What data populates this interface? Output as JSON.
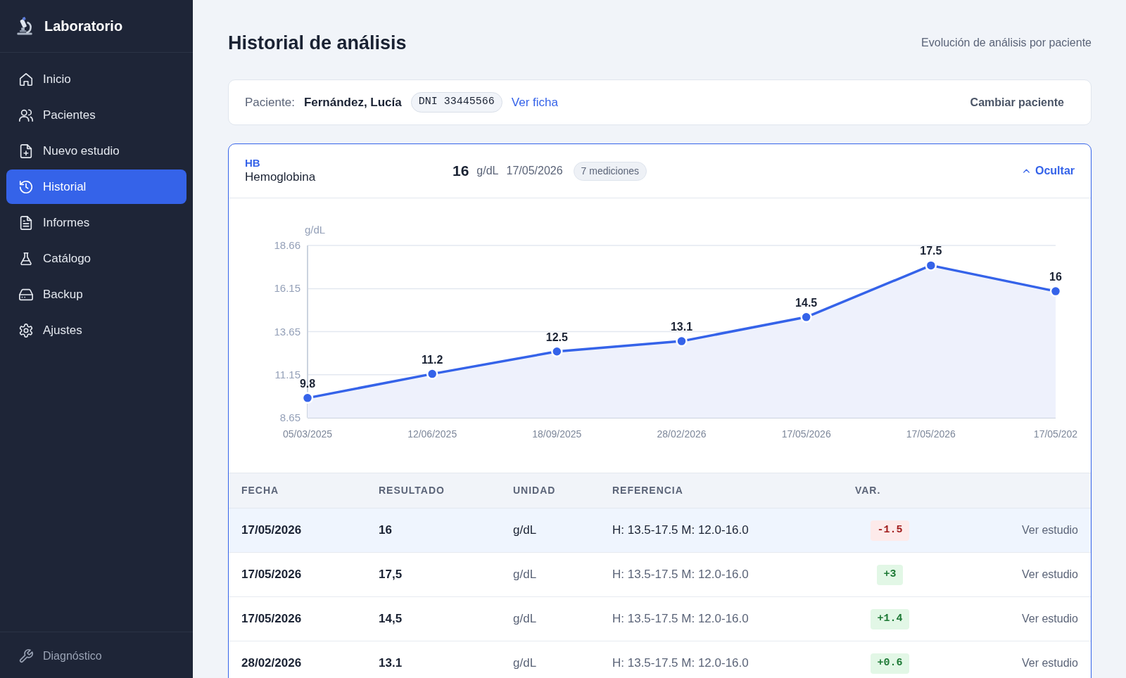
{
  "sidebar": {
    "brand": "Laboratorio",
    "items": [
      {
        "label": "Inicio",
        "selected": false
      },
      {
        "label": "Pacientes",
        "selected": false
      },
      {
        "label": "Nuevo estudio",
        "selected": false
      },
      {
        "label": "Historial",
        "selected": true
      },
      {
        "label": "Informes",
        "selected": false
      },
      {
        "label": "Catálogo",
        "selected": false
      },
      {
        "label": "Backup",
        "selected": false
      },
      {
        "label": "Ajustes",
        "selected": false
      }
    ],
    "footer_item": {
      "label": "Diagnóstico"
    }
  },
  "header": {
    "title": "Historial de análisis",
    "subtitle": "Evolución de análisis por paciente"
  },
  "patient": {
    "label": "Paciente:",
    "name": "Fernández, Lucía",
    "document": "DNI 33445566",
    "link": "Ver ficha",
    "change_button": "Cambiar paciente"
  },
  "analysis": {
    "code": "HB",
    "name": "Hemoglobina",
    "latest_value": "16",
    "unit": "g/dL",
    "date": "17/05/2026",
    "count": "7 mediciones",
    "toggle": {
      "label": "Ocultar",
      "expanded": true
    },
    "chart_data": {
      "type": "area",
      "ylabel": "g/dL",
      "categories": [
        "05/03/2025",
        "12/06/2025",
        "18/09/2025",
        "28/02/2026",
        "17/05/2026",
        "17/05/2026",
        "17/05/202"
      ],
      "values": [
        9.8,
        11.2,
        12.5,
        13.1,
        14.5,
        17.5,
        16
      ],
      "ylim": [
        8.65,
        18.66
      ],
      "yticks": [
        8.65,
        11.15,
        13.65,
        16.15,
        18.66
      ],
      "grid": true,
      "data_labels": true
    },
    "table": {
      "columns": [
        "FECHA",
        "RESULTADO",
        "UNIDAD",
        "REFERENCIA",
        "VAR."
      ],
      "rows": [
        {
          "date": "17/05/2026",
          "result": "16",
          "unit": "g/dL",
          "reference": "H: 13.5-17.5 M: 12.0-16.0",
          "change": "-1.5",
          "negative": true,
          "action": "Ver estudio",
          "selected": true
        },
        {
          "date": "17/05/2026",
          "result": "17,5",
          "unit": "g/dL",
          "reference": "H: 13.5-17.5 M: 12.0-16.0",
          "change": "+3",
          "negative": false,
          "action": "Ver estudio",
          "selected": false
        },
        {
          "date": "17/05/2026",
          "result": "14,5",
          "unit": "g/dL",
          "reference": "H: 13.5-17.5 M: 12.0-16.0",
          "change": "+1.4",
          "negative": false,
          "action": "Ver estudio",
          "selected": false
        },
        {
          "date": "28/02/2026",
          "result": "13.1",
          "unit": "g/dL",
          "reference": "H: 13.5-17.5 M: 12.0-16.0",
          "change": "+0.6",
          "negative": false,
          "action": "Ver estudio",
          "selected": false
        }
      ]
    }
  }
}
